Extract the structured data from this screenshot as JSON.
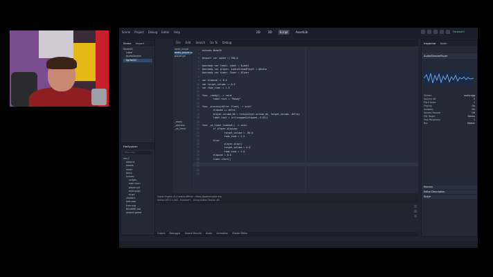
{
  "menu": [
    "Scene",
    "Project",
    "Debug",
    "Editor",
    "Help"
  ],
  "workspaces": [
    {
      "label": "2D",
      "active": false
    },
    {
      "label": "3D",
      "active": false
    },
    {
      "label": "Script",
      "active": true
    },
    {
      "label": "AssetLib",
      "active": false
    }
  ],
  "renderer": "Forward+",
  "scene_panel": {
    "tabs": [
      "Scene",
      "Import"
    ],
    "items": [
      "Node2D",
      "Label",
      "AudioStream",
      "Sprite2D"
    ]
  },
  "filesystem": {
    "title": "FileSystem",
    "search": "Filter Files",
    "items": [
      "res://",
      "addons",
      "assets",
      "audio",
      "fonts",
      "scenes",
      "scripts",
      "main.tscn",
      "player.gd",
      "enemy.gd",
      "ui.gd",
      "shaders",
      "textures",
      "icon.svg",
      "README.md",
      "project.godot"
    ]
  },
  "editor": {
    "tabs": [
      "File",
      "Edit",
      "Search",
      "Go To",
      "Debug"
    ],
    "scripts": [
      "node_2d.gd",
      "audio_player.gd",
      "player.gd"
    ],
    "methods": [
      "_ready",
      "_process",
      "_on_timer"
    ],
    "code": [
      "extends Node2D",
      "",
      "@export var speed := 200.0",
      "",
      "@onready var label: Label = $Label",
      "@onready var player: AudioStreamPlayer = $Audio",
      "@onready var timer: Timer = $Timer",
      "",
      "var elapsed := 0.0",
      "var target_volume := 0.0",
      "var fade_time := 1.5",
      "",
      "func _ready() -> void:",
      "\tlabel.text = \"Ready\"",
      "",
      "func _process(delta: float) -> void:",
      "\telapsed += delta",
      "\tplayer.volume_db = lerp(player.volume_db, target_volume, delta)",
      "\tlabel.text = str(snapped(elapsed, 0.01))",
      "",
      "func _on_timer_timeout() -> void:",
      "\tif player.playing:",
      "\t\ttarget_volume = -80.0",
      "\t\tfade_time = 1.5",
      "\telse:",
      "\t\tplayer.play()",
      "\t\ttarget_volume = 0.0",
      "\t\tfade_time = 1.0",
      "\telapsed = 0.0",
      "\ttimer.start()",
      "",
      "",
      "",
      ""
    ]
  },
  "output": {
    "lines": [
      "Godot Engine v4.2.stable.official - https://godotengine.org",
      "Vulkan API 1.3.242 - Forward+ - Using Vulkan Device #0"
    ]
  },
  "bottom_tabs": [
    "Output",
    "Debugger",
    "Search Results",
    "Audio",
    "Animation",
    "Shader Editor"
  ],
  "inspector": {
    "tabs": [
      "Inspector",
      "Node"
    ],
    "node": "AudioStreamPlayer",
    "props": [
      [
        "Stream",
        "audio.ogg"
      ],
      [
        "Volume dB",
        "0"
      ],
      [
        "Pitch Scale",
        "1"
      ],
      [
        "Playing",
        "On"
      ],
      [
        "Autoplay",
        "On"
      ],
      [
        "Stream Paused",
        "Off"
      ],
      [
        "Mix Target",
        "Stereo"
      ],
      [
        "Max Polyphony",
        "1"
      ],
      [
        "Bus",
        "Master"
      ]
    ],
    "sections": [
      "Process",
      "Editor Description",
      "Script"
    ]
  }
}
